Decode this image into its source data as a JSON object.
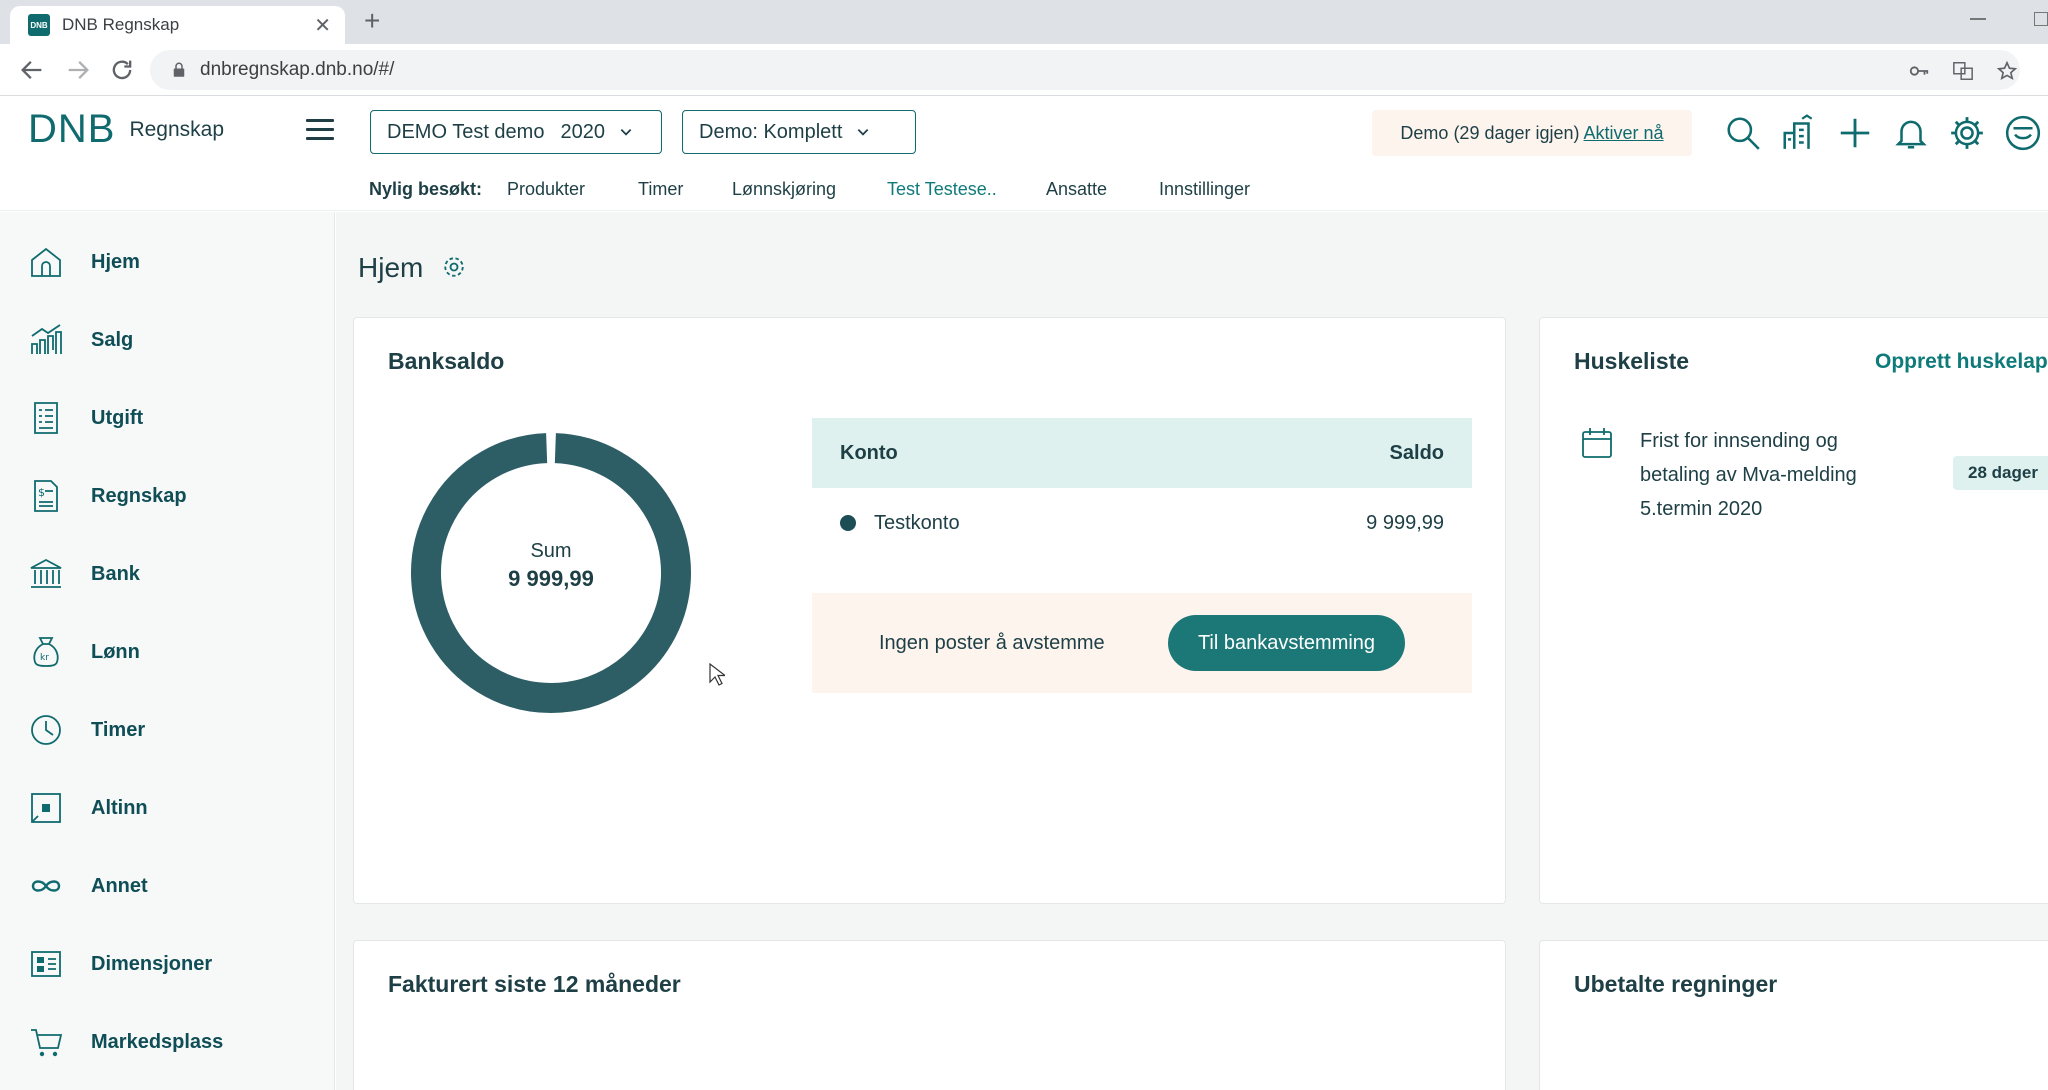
{
  "browser": {
    "tab_title": "DNB Regnskap",
    "favicon_text": "DNB",
    "url": "dnbregnskap.dnb.no/#/"
  },
  "header": {
    "logo_text": "DNB",
    "app_name": "Regnskap",
    "company_select": {
      "label": "DEMO Test demo",
      "year": "2020"
    },
    "plan_select": {
      "label": "Demo: Komplett"
    },
    "trial_text": "Demo (29 dager igjen)",
    "trial_link": "Aktiver nå"
  },
  "recent": {
    "label": "Nylig besøkt:",
    "links": [
      "Produkter",
      "Timer",
      "Lønnskjøring",
      "Test Testese..",
      "Ansatte",
      "Innstillinger"
    ]
  },
  "sidebar": {
    "items": [
      {
        "label": "Hjem",
        "icon": "home-icon"
      },
      {
        "label": "Salg",
        "icon": "sales-chart-icon"
      },
      {
        "label": "Utgift",
        "icon": "receipt-icon"
      },
      {
        "label": "Regnskap",
        "icon": "ledger-icon"
      },
      {
        "label": "Bank",
        "icon": "bank-icon"
      },
      {
        "label": "Lønn",
        "icon": "money-bag-icon"
      },
      {
        "label": "Timer",
        "icon": "clock-icon"
      },
      {
        "label": "Altinn",
        "icon": "altinn-icon"
      },
      {
        "label": "Annet",
        "icon": "infinity-icon"
      },
      {
        "label": "Dimensjoner",
        "icon": "dimensions-icon"
      },
      {
        "label": "Markedsplass",
        "icon": "cart-icon"
      }
    ]
  },
  "main": {
    "page_title": "Hjem",
    "banksaldo": {
      "title": "Banksaldo",
      "sum_label": "Sum",
      "sum_value": "9 999,99",
      "table": {
        "col_account": "Konto",
        "col_balance": "Saldo",
        "rows": [
          {
            "account": "Testkonto",
            "balance": "9 999,99",
            "share": 1.0
          }
        ]
      },
      "recon_text": "Ingen poster å avstemme",
      "recon_button": "Til bankavstemming"
    },
    "huskeliste": {
      "title": "Huskeliste",
      "create_link": "Opprett huskelap",
      "tasks": [
        {
          "text": "Frist for innsending og betaling av Mva-melding 5.termin 2020",
          "badge": "28 dager"
        }
      ]
    },
    "fakturert": {
      "title": "Fakturert siste 12 måneder"
    },
    "ubetalte": {
      "title": "Ubetalte regninger"
    }
  },
  "colors": {
    "accent": "#0f6b6e",
    "donut": "#2d5e66",
    "button": "#1c7877",
    "table_head": "#dff1ee",
    "notice_bg": "#fdf4ee"
  }
}
